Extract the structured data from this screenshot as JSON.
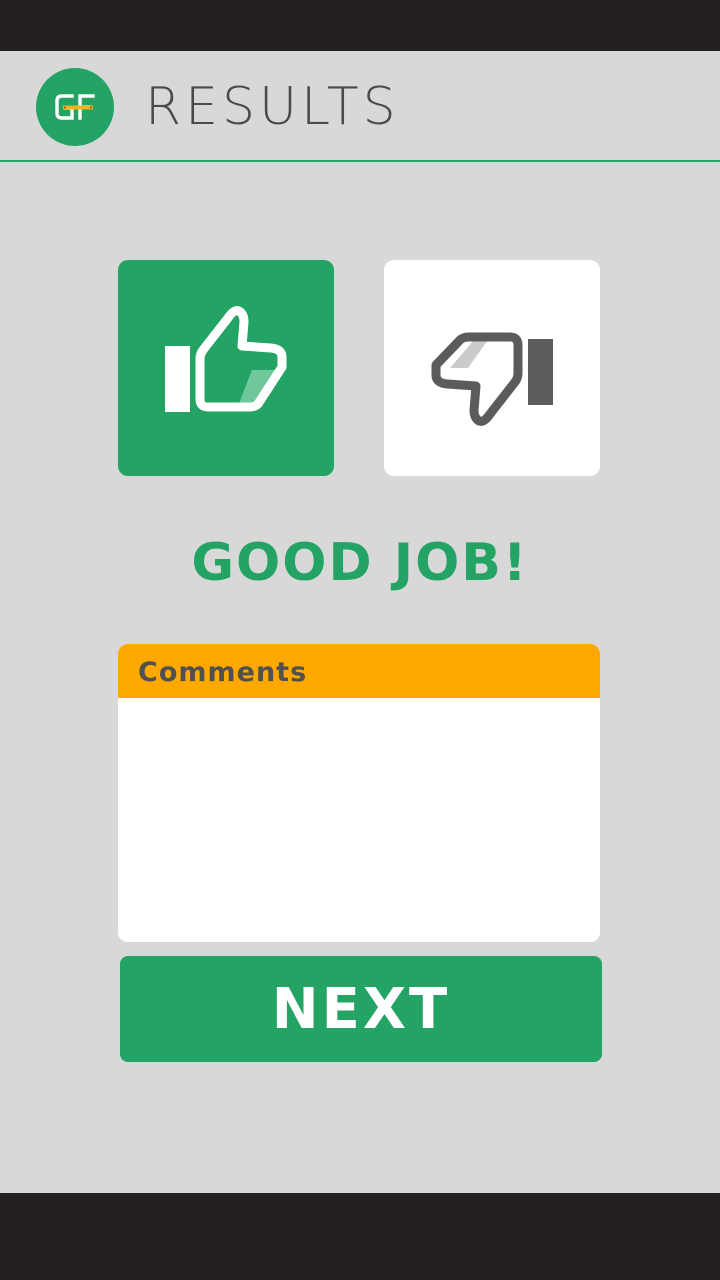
{
  "colors": {
    "brand_green": "#23a464",
    "accent_orange": "#ffa800",
    "background": "#d8d8d8",
    "system_bar": "#231f20"
  },
  "header": {
    "logo_text": "GF",
    "title": "RESULTS"
  },
  "vote": {
    "up": {
      "icon": "thumbs-up-icon",
      "selected": true
    },
    "down": {
      "icon": "thumbs-down-icon",
      "selected": false
    }
  },
  "result": {
    "message": "GOOD JOB!"
  },
  "comments": {
    "label": "Comments",
    "value": ""
  },
  "actions": {
    "next_label": "NEXT"
  }
}
